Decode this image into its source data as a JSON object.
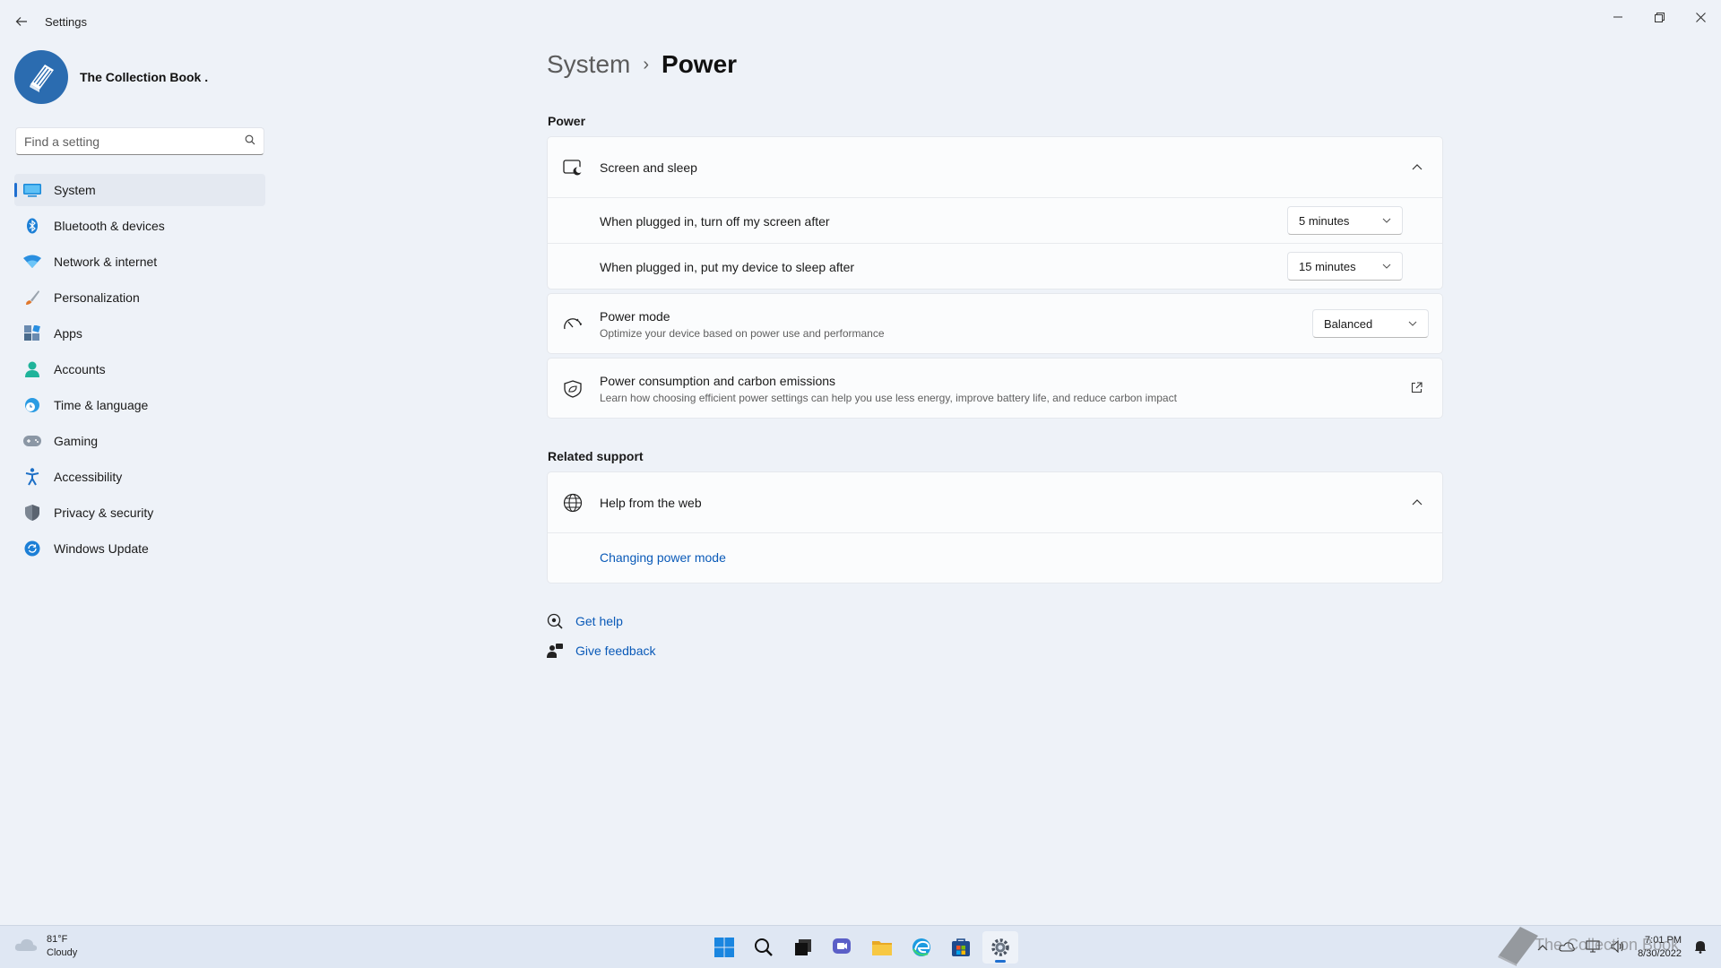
{
  "window": {
    "title": "Settings"
  },
  "profile": {
    "name": "The Collection Book ."
  },
  "search": {
    "placeholder": "Find a setting"
  },
  "sidebar": {
    "items": [
      {
        "label": "System",
        "icon": "system-icon",
        "active": true
      },
      {
        "label": "Bluetooth & devices",
        "icon": "bluetooth-icon"
      },
      {
        "label": "Network & internet",
        "icon": "wifi-icon"
      },
      {
        "label": "Personalization",
        "icon": "brush-icon"
      },
      {
        "label": "Apps",
        "icon": "apps-icon"
      },
      {
        "label": "Accounts",
        "icon": "person-icon"
      },
      {
        "label": "Time & language",
        "icon": "clock-globe-icon"
      },
      {
        "label": "Gaming",
        "icon": "gamepad-icon"
      },
      {
        "label": "Accessibility",
        "icon": "accessibility-icon"
      },
      {
        "label": "Privacy & security",
        "icon": "shield-icon"
      },
      {
        "label": "Windows Update",
        "icon": "update-icon"
      }
    ]
  },
  "breadcrumb": {
    "parent": "System",
    "separator": "›",
    "current": "Power"
  },
  "power_section": {
    "heading": "Power",
    "screen_sleep": {
      "title": "Screen and sleep",
      "rows": [
        {
          "label": "When plugged in, turn off my screen after",
          "value": "5 minutes"
        },
        {
          "label": "When plugged in, put my device to sleep after",
          "value": "15 minutes"
        }
      ]
    },
    "power_mode": {
      "title": "Power mode",
      "subtitle": "Optimize your device based on power use and performance",
      "value": "Balanced"
    },
    "consumption": {
      "title": "Power consumption and carbon emissions",
      "subtitle": "Learn how choosing efficient power settings can help you use less energy, improve battery life, and reduce carbon impact"
    }
  },
  "related_support": {
    "heading": "Related support",
    "help_web": {
      "title": "Help from the web",
      "links": [
        "Changing power mode"
      ]
    }
  },
  "footer_links": {
    "get_help": "Get help",
    "give_feedback": "Give feedback"
  },
  "taskbar": {
    "weather_temp": "81°F",
    "weather_desc": "Cloudy",
    "apps": [
      "start-icon",
      "search-icon",
      "task-view-icon",
      "chat-icon",
      "file-explorer-icon",
      "edge-icon",
      "store-icon",
      "settings-icon"
    ],
    "time": "7:01 PM",
    "date": "8/30/2022"
  },
  "watermark": {
    "text": "The Collection Book"
  },
  "colors": {
    "accent": "#1f6fd0",
    "link": "#0a5ab8",
    "background": "#eef2f8",
    "card": "#fbfcfd"
  }
}
